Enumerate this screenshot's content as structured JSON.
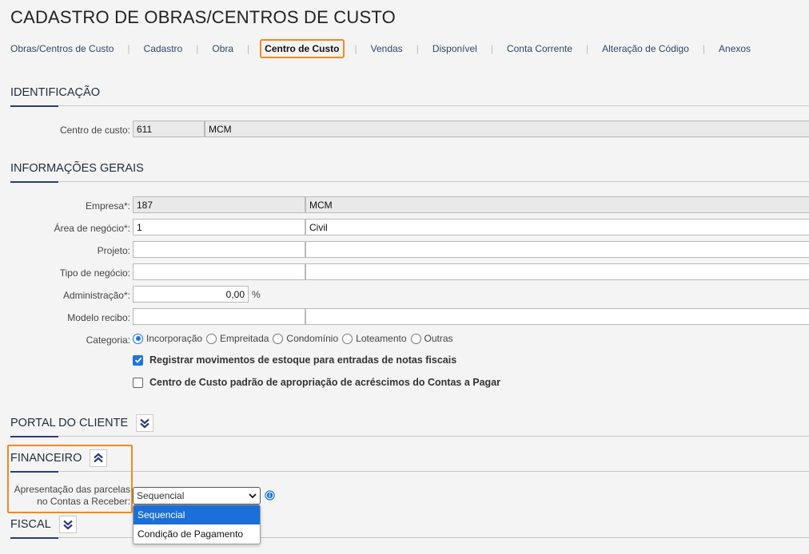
{
  "page": {
    "title": "CADASTRO DE OBRAS/CENTROS DE CUSTO"
  },
  "tabs": [
    {
      "label": "Obras/Centros de Custo"
    },
    {
      "label": "Cadastro"
    },
    {
      "label": "Obra"
    },
    {
      "label": "Centro de Custo",
      "active": true
    },
    {
      "label": "Vendas"
    },
    {
      "label": "Disponível"
    },
    {
      "label": "Conta Corrente"
    },
    {
      "label": "Alteração de Código"
    },
    {
      "label": "Anexos"
    }
  ],
  "identificacao": {
    "title": "IDENTIFICAÇÃO",
    "centro_custo_label": "Centro de custo:",
    "centro_custo_code": "611",
    "centro_custo_name": "MCM"
  },
  "informacoes": {
    "title": "INFORMAÇÕES GERAIS",
    "empresa_label": "Empresa*:",
    "empresa_code": "187",
    "empresa_name": "MCM",
    "area_label": "Área de negócio*:",
    "area_code": "1",
    "area_name": "Civil",
    "projeto_label": "Projeto:",
    "projeto_code": "",
    "projeto_name": "",
    "tipo_label": "Tipo de negócio:",
    "tipo_code": "",
    "tipo_name": "",
    "admin_label": "Administração*:",
    "admin_value": "0,00",
    "admin_unit": "%",
    "modelo_label": "Modelo recibo:",
    "modelo_code": "",
    "modelo_name": "",
    "categoria_label": "Categoria:",
    "categorias": [
      "Incorporação",
      "Empreitada",
      "Condomínio",
      "Loteamento",
      "Outras"
    ],
    "categoria_selected": "Incorporação",
    "check_estoque": "Registrar movimentos de estoque para entradas de notas fiscais",
    "check_estoque_checked": true,
    "check_acrescimos": "Centro de Custo padrão de apropriação de acréscimos do Contas a Pagar",
    "check_acrescimos_checked": false
  },
  "portal": {
    "title": "PORTAL DO CLIENTE"
  },
  "financeiro": {
    "title": "FINANCEIRO",
    "parcelas_label_1": "Apresentação das parcelas",
    "parcelas_label_2": "no Contas a Receber:",
    "parcelas_value": "Sequencial",
    "options": [
      "Sequencial",
      "Condição de Pagamento"
    ]
  },
  "fiscal": {
    "title": "FISCAL"
  },
  "colors": {
    "accent": "#1a73e8",
    "highlight": "#f28a1e",
    "section_underline": "#2e3a7a"
  }
}
